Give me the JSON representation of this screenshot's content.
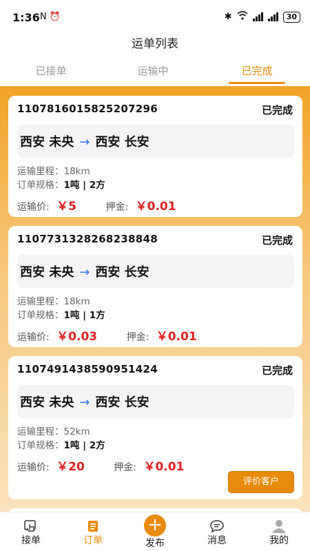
{
  "status_bar": {
    "time": "1:36",
    "left_icons": "N ⏰",
    "battery": "30"
  },
  "header": {
    "title": "运单列表"
  },
  "tabs": [
    {
      "label": "已接单",
      "active": false
    },
    {
      "label": "运输中",
      "active": false
    },
    {
      "label": "已完成",
      "active": true
    }
  ],
  "orders": [
    {
      "order_no": "1107816015825207296",
      "status": "已完成",
      "origin": "西安 未央",
      "destination": "西安 长安",
      "distance_label": "运输里程：",
      "distance": "18km",
      "spec_label": "订单规格：",
      "spec": "1吨 | 2方",
      "freight_label": "运输价:",
      "freight": "￥5",
      "deposit_label": "押金:",
      "deposit": "￥0.01"
    },
    {
      "order_no": "1107731328268238848",
      "status": "已完成",
      "origin": "西安 未央",
      "destination": "西安 长安",
      "distance_label": "运输里程：",
      "distance": "18km",
      "spec_label": "订单规格：",
      "spec": "1吨 | 1方",
      "freight_label": "运输价:",
      "freight": "￥0.03",
      "deposit_label": "押金:",
      "deposit": "￥0.01"
    },
    {
      "order_no": "1107491438590951424",
      "status": "已完成",
      "origin": "西安 未央",
      "destination": "西安 长安",
      "distance_label": "运输里程：",
      "distance": "52km",
      "spec_label": "订单规格：",
      "spec": "1吨 | 2方",
      "freight_label": "运输价:",
      "freight": "￥20",
      "deposit_label": "押金:",
      "deposit": "￥0.01",
      "action_label": "评价客户"
    }
  ],
  "route_arrow": "→",
  "bottom_nav": [
    {
      "label": "接单",
      "icon": "hand-tap-icon",
      "active": false
    },
    {
      "label": "订单",
      "icon": "order-list-icon",
      "active": true
    },
    {
      "label": "发布",
      "icon": "plus-circle-icon",
      "active": false
    },
    {
      "label": "消息",
      "icon": "chat-bubble-icon",
      "active": false
    },
    {
      "label": "我的",
      "icon": "user-avatar-icon",
      "active": false
    }
  ],
  "colors": {
    "accent": "#e88a0b",
    "price": "#e02121",
    "arrow": "#2f6fe4"
  }
}
